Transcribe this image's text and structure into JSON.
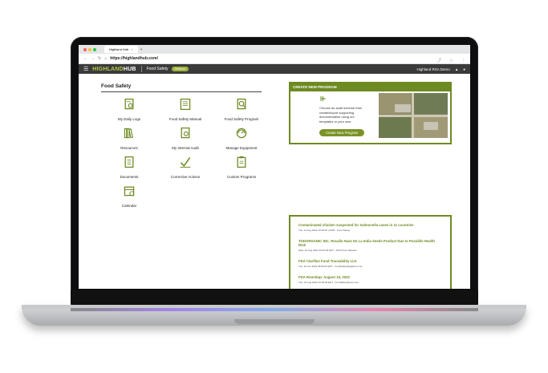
{
  "browser": {
    "tab_title": "Highland Hub",
    "tab_close": "×",
    "new_tab": "+",
    "url": "https://highlandhub.com/",
    "nav": [
      "←",
      "→",
      "↻",
      "⌂"
    ],
    "actions": [
      "⤴",
      "☆",
      "⋮"
    ]
  },
  "app": {
    "logo_main": "HIGHLAND",
    "logo_sub": "HUB",
    "module_title": "Food Safety",
    "pill_label": "Reliance",
    "account_name": "Highland RSA Demo",
    "hamburger": "☰",
    "bell": "▲",
    "user": "●"
  },
  "food_safety": {
    "title": "Food Safety",
    "items": [
      {
        "label": "My Daily Logs",
        "icon": "daily-logs-icon"
      },
      {
        "label": "Food Safety Manual",
        "icon": "manual-icon"
      },
      {
        "label": "Food Safety Program",
        "icon": "program-icon"
      },
      {
        "label": "Resources",
        "icon": "resources-icon"
      },
      {
        "label": "My Internal Audit",
        "icon": "audit-icon"
      },
      {
        "label": "Manage Equipment",
        "icon": "equipment-icon"
      },
      {
        "label": "Documents",
        "icon": "documents-icon"
      },
      {
        "label": "Corrective Actions",
        "icon": "corrective-icon"
      },
      {
        "label": "Custom Programs",
        "icon": "custom-programs-icon"
      },
      {
        "label": "Calendar",
        "icon": "calendar-icon"
      }
    ]
  },
  "create_program": {
    "header": "CREATE NEW PROGRAM",
    "text": "Choose an audit scheme then create/import supporting documentation using our templates or your own.",
    "button": "Create New Program",
    "image_alt": "aerial view of farm fields"
  },
  "news": [
    {
      "title": "Contaminated chicken suspected for Salmonella cases in 11 countries",
      "meta": "Thu, 11 Aug 2022 10:38:00 +0000 · Food Safety"
    },
    {
      "title": "TODORGANIC INC. Recalls Nuez De La India Seeds Product Due to Possible Health Risk",
      "meta": "Wed, 10 Aug 2022 20:02:00 EDT · FDA Press Release"
    },
    {
      "title": "FDA Clarifies Food Traceability List",
      "meta": "Tue, 16 Jun 2022 08:00:00 EDT · FoodSafetyMagazine.com"
    },
    {
      "title": "FDA Roundup: August 19, 2022",
      "meta": "Thu, 19 Aug 2022 15:36:00 EDT · FoodSafetyNews.com"
    }
  ],
  "colors": {
    "accent": "#6e8a22",
    "header_bg": "#3b3b3b",
    "logo": "#b6c94a"
  }
}
